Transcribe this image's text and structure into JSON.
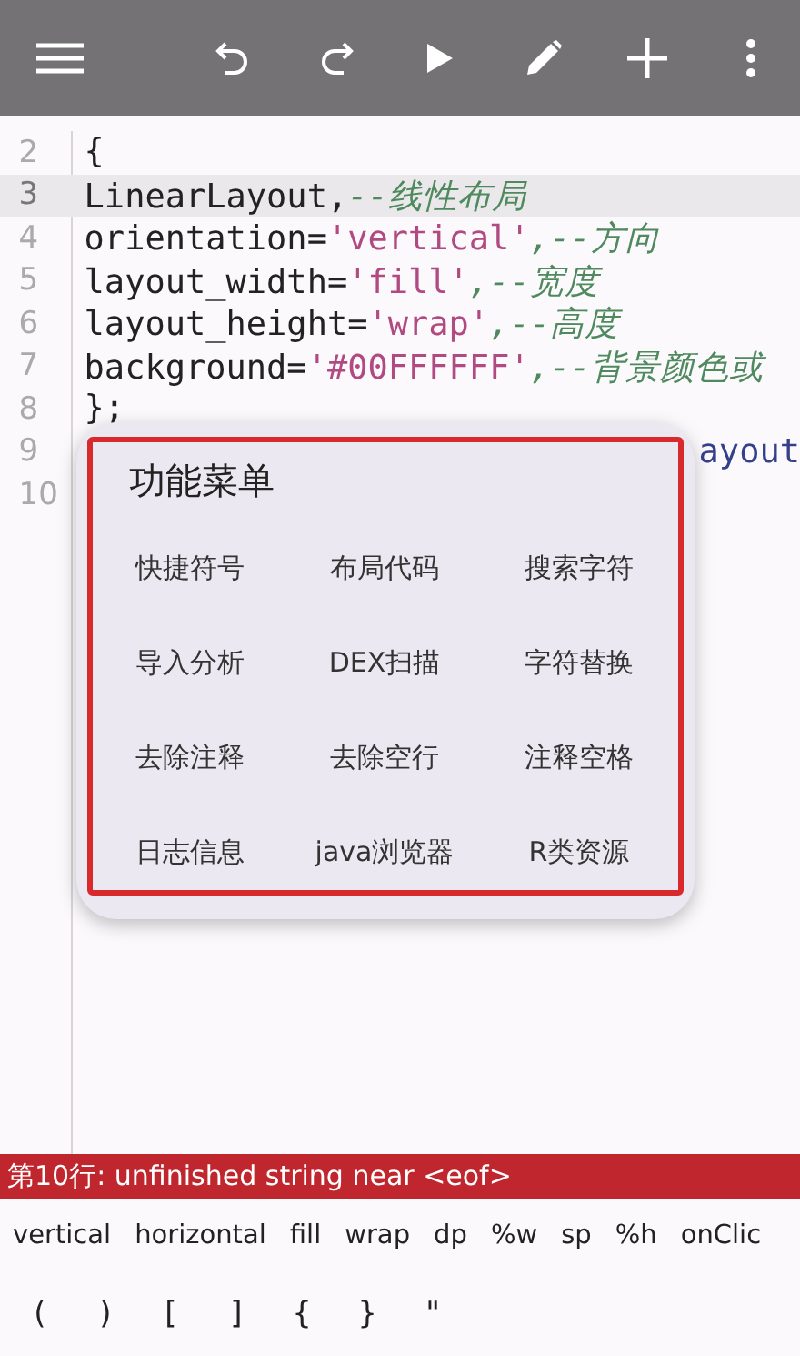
{
  "toolbar": {
    "buttons": [
      {
        "kind": "menu"
      },
      {
        "kind": "undo"
      },
      {
        "kind": "redo"
      },
      {
        "kind": "run"
      },
      {
        "kind": "edit"
      },
      {
        "kind": "add"
      },
      {
        "kind": "more"
      }
    ]
  },
  "editor": {
    "lines": [
      {
        "number": "2",
        "current": false,
        "tokens": [
          {
            "kind": "plain",
            "text": "{"
          }
        ]
      },
      {
        "number": "3",
        "current": true,
        "tokens": [
          {
            "kind": "plain",
            "text": "LinearLayout,"
          },
          {
            "kind": "comment",
            "text": "--线性布局"
          }
        ]
      },
      {
        "number": "4",
        "current": false,
        "tokens": [
          {
            "kind": "plain",
            "text": "orientation="
          },
          {
            "kind": "string",
            "text": "'vertical'"
          },
          {
            "kind": "comment",
            "text": ",--方向"
          }
        ]
      },
      {
        "number": "5",
        "current": false,
        "tokens": [
          {
            "kind": "plain",
            "text": "layout_width="
          },
          {
            "kind": "string",
            "text": "'fill'"
          },
          {
            "kind": "comment",
            "text": ",--宽度"
          }
        ]
      },
      {
        "number": "6",
        "current": false,
        "tokens": [
          {
            "kind": "plain",
            "text": "layout_height="
          },
          {
            "kind": "string",
            "text": "'wrap'"
          },
          {
            "kind": "comment",
            "text": ",--高度"
          }
        ]
      },
      {
        "number": "7",
        "current": false,
        "tokens": [
          {
            "kind": "plain",
            "text": "background="
          },
          {
            "kind": "string",
            "text": "'#00FFFFFF'"
          },
          {
            "kind": "comment",
            "text": ",--背景颜色或"
          }
        ]
      },
      {
        "number": "8",
        "current": false,
        "tokens": [
          {
            "kind": "plain",
            "text": "};"
          }
        ]
      },
      {
        "number": "9",
        "current": false,
        "tokens": [
          {
            "kind": "tail",
            "text": "ayout"
          }
        ]
      },
      {
        "number": "10",
        "current": false
      }
    ]
  },
  "popup": {
    "title": "功能菜单",
    "items": [
      "快捷符号",
      "布局代码",
      "搜索字符",
      "导入分析",
      "DEX扫描",
      "字符替换",
      "去除注释",
      "去除空行",
      "注释空格",
      "日志信息",
      "java浏览器",
      "R类资源"
    ]
  },
  "status_bar": {
    "message": "第10行: unfinished string near <eof>"
  },
  "suggestions": [
    "vertical",
    "horizontal",
    "fill",
    "wrap",
    "dp",
    "%w",
    "sp",
    "%h",
    "onClic"
  ],
  "symbols": [
    "(",
    ")",
    "[",
    "]",
    "{",
    "}",
    "\""
  ]
}
